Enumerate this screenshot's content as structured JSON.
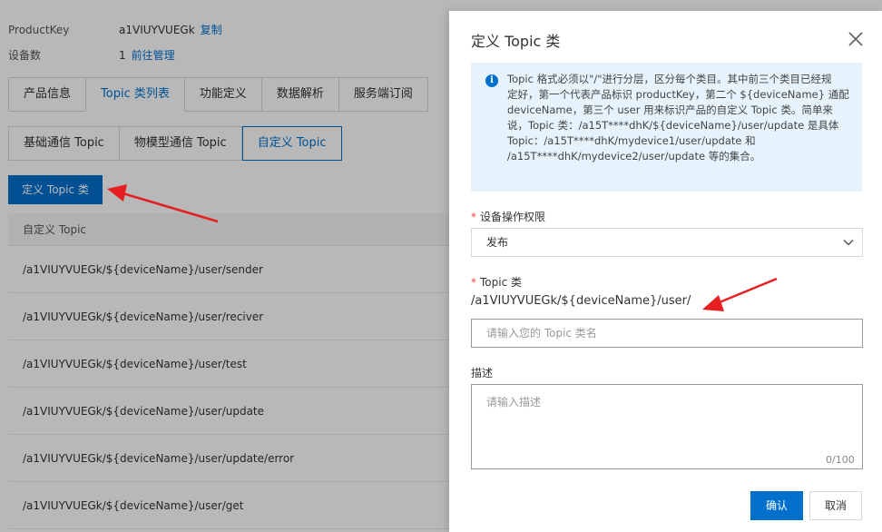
{
  "product": {
    "product_key_label": "ProductKey",
    "product_key_value": "a1VIUYVUEGk",
    "copy_link": "复制",
    "device_count_label": "设备数",
    "device_count_value": "1",
    "manage_link": "前往管理"
  },
  "tabs": [
    "产品信息",
    "Topic 类列表",
    "功能定义",
    "数据解析",
    "服务端订阅"
  ],
  "subtabs": [
    "基础通信 Topic",
    "物模型通信 Topic",
    "自定义 Topic"
  ],
  "define_button": "定义 Topic 类",
  "table": {
    "header": "自定义 Topic",
    "rows": [
      "/a1VIUYVUEGk/${deviceName}/user/sender",
      "/a1VIUYVUEGk/${deviceName}/user/reciver",
      "/a1VIUYVUEGk/${deviceName}/user/test",
      "/a1VIUYVUEGk/${deviceName}/user/update",
      "/a1VIUYVUEGk/${deviceName}/user/update/error",
      "/a1VIUYVUEGk/${deviceName}/user/get"
    ]
  },
  "dialog": {
    "title": "定义 Topic 类",
    "notice_lines": [
      "Topic 格式必须以\"/\"进行分层，区分每个类目。其中前三个类目已经规",
      "定好，第一个代表产品标识 productKey，第二个 ${deviceName} 通配",
      "deviceName，第三个 user 用来标识产品的自定义 Topic 类。简单来",
      "说，Topic 类：/a15T****dhK/${deviceName}/user/update 是具体",
      "Topic：/a15T****dhK/mydevice1/user/update 和",
      "/a15T****dhK/mydevice2/user/update 等的集合。"
    ],
    "permission_label": "设备操作权限",
    "permission_value": "发布",
    "topic_label": "Topic 类",
    "topic_prefix": "/a1VIUYVUEGk/${deviceName}/user/",
    "topic_placeholder": "请输入您的 Topic 类名",
    "desc_label": "描述",
    "desc_placeholder": "请输入描述",
    "desc_counter": "0/100",
    "ok_label": "确认",
    "cancel_label": "取消",
    "required_mark": "*"
  },
  "colors": {
    "accent": "#0070cc",
    "arrow": "#e62020",
    "notice_bg": "#e6f3fc"
  },
  "icons": {
    "info": "info-icon",
    "close": "close-icon",
    "chevron": "chevron-down-icon"
  }
}
